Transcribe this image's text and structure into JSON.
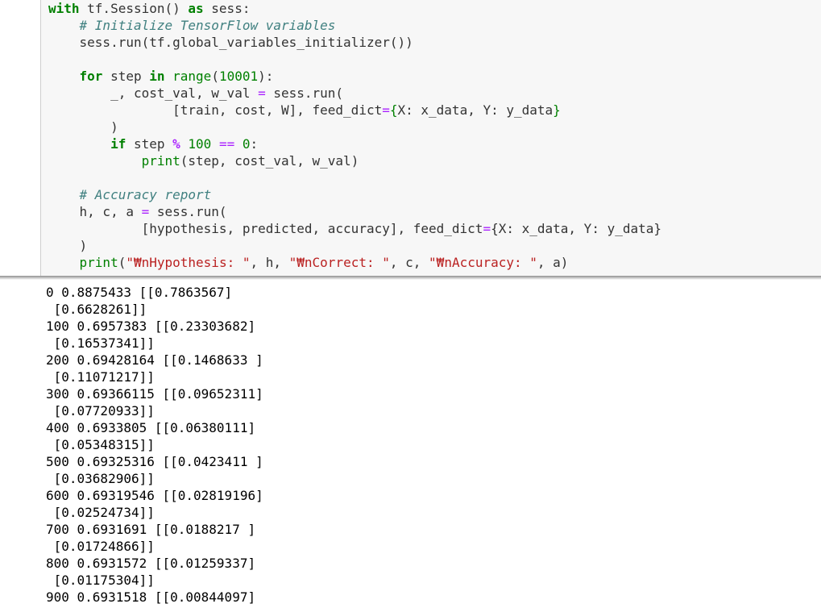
{
  "code": {
    "line1": {
      "kw_with": "with",
      "t1": " tf.Session() ",
      "kw_as": "as",
      "t2": " sess:"
    },
    "line2": {
      "indent": "    ",
      "comment": "# Initialize TensorFlow variables"
    },
    "line3": {
      "text": "    sess.run(tf.global_variables_initializer())"
    },
    "line4": {
      "text": ""
    },
    "line5": {
      "indent": "    ",
      "kw_for": "for",
      "t1": " step ",
      "kw_in": "in",
      "sp": " ",
      "bi_range": "range",
      "t2": "(",
      "num": "10001",
      "t3": "):"
    },
    "line6": {
      "t1": "        _, cost_val, w_val ",
      "op": "=",
      "t2": " sess.run("
    },
    "line7": {
      "t1": "                [train, cost, W], feed_dict",
      "op": "=",
      "brace_open": "{",
      "t2": "X: x_data, Y: y_data",
      "brace_close": "}"
    },
    "line8": {
      "text": "        )"
    },
    "line9": {
      "indent": "        ",
      "kw_if": "if",
      "t1": " step ",
      "op_mod": "%",
      "sp": " ",
      "num1": "100",
      "sp2": " ",
      "op_eq": "==",
      "sp3": " ",
      "num2": "0",
      "t2": ":"
    },
    "line10": {
      "indent": "            ",
      "bi_print": "print",
      "t1": "(step, cost_val, w_val)"
    },
    "line11": {
      "text": ""
    },
    "line12": {
      "indent": "    ",
      "comment": "# Accuracy report"
    },
    "line13": {
      "t1": "    h, c, a ",
      "op": "=",
      "t2": " sess.run("
    },
    "line14": {
      "t1": "            [hypothesis, predicted, accuracy], feed_dict",
      "op": "=",
      "brace_open": "{",
      "t2": "X: x_data, Y: y_data",
      "brace_close": "}"
    },
    "line15": {
      "text": "    )"
    },
    "line16": {
      "indent": "    ",
      "bi_print": "print",
      "t1": "(",
      "s1": "\"₩nHypothesis: \"",
      "t2": ", h, ",
      "s2": "\"₩nCorrect: \"",
      "t3": ", c, ",
      "s3": "\"₩nAccuracy: \"",
      "t4": ", a)"
    }
  },
  "output": [
    "0 0.8875433 [[0.7863567]",
    " [0.6628261]]",
    "100 0.6957383 [[0.23303682]",
    " [0.16537341]]",
    "200 0.69428164 [[0.1468633 ]",
    " [0.11071217]]",
    "300 0.69366115 [[0.09652311]",
    " [0.07720933]]",
    "400 0.6933805 [[0.06380111]",
    " [0.05348315]]",
    "500 0.69325316 [[0.0423411 ]",
    " [0.03682906]]",
    "600 0.69319546 [[0.02819196]",
    " [0.02524734]]",
    "700 0.6931691 [[0.0188217 ]",
    " [0.01724866]]",
    "800 0.6931572 [[0.01259337]",
    " [0.01175304]]",
    "900 0.6931518 [[0.00844097]"
  ]
}
